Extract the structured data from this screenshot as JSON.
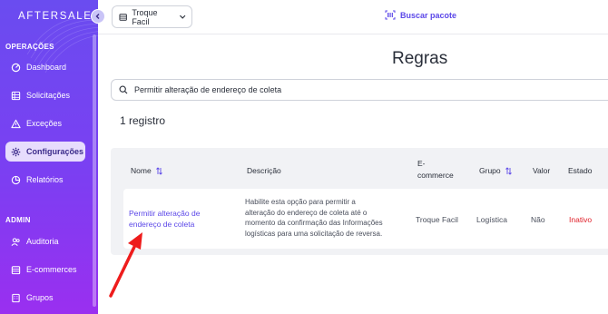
{
  "brand": {
    "logo_text": "AFTERSALE",
    "accent": "#5b47e8",
    "sidebar_gradient": [
      "#6a4cf0",
      "#9a2ff0"
    ]
  },
  "sidebar": {
    "sections": [
      {
        "label": "OPERAÇÕES",
        "items": [
          {
            "label": "Dashboard",
            "icon": "dashboard-icon"
          },
          {
            "label": "Solicitações",
            "icon": "list-icon"
          },
          {
            "label": "Exceções",
            "icon": "warning-icon"
          },
          {
            "label": "Configurações",
            "icon": "gear-icon",
            "active": true
          },
          {
            "label": "Relatórios",
            "icon": "report-icon"
          }
        ]
      },
      {
        "label": "ADMIN",
        "items": [
          {
            "label": "Auditoria",
            "icon": "users-icon"
          },
          {
            "label": "E-commerces",
            "icon": "store-icon"
          },
          {
            "label": "Grupos",
            "icon": "building-icon"
          }
        ]
      }
    ]
  },
  "topbar": {
    "store_selected": "Troque Facil",
    "track_label": "Buscar pacote"
  },
  "page": {
    "title": "Regras",
    "search_value": "Permitir alteração de endereço de coleta",
    "count_label": "1 registro"
  },
  "table": {
    "headers": {
      "name": "Nome",
      "description": "Descrição",
      "ecommerce_line1": "E-",
      "ecommerce_line2": "commerce",
      "group": "Grupo",
      "value": "Valor",
      "status": "Estado"
    },
    "rows": [
      {
        "name_line1": "Permitir alteração de",
        "name_line2": "endereço de coleta",
        "desc_line1": "Habilite esta opção para permitir a",
        "desc_line2": "alteração do endereço de coleta até o",
        "desc_line3": "momento da confirmação das Informações",
        "desc_line4": "logísticas para uma solicitação de reversa.",
        "ecommerce": "Troque Facil",
        "group": "Logística",
        "value": "Não",
        "status": "Inativo",
        "status_color": "#e0202a"
      }
    ]
  }
}
